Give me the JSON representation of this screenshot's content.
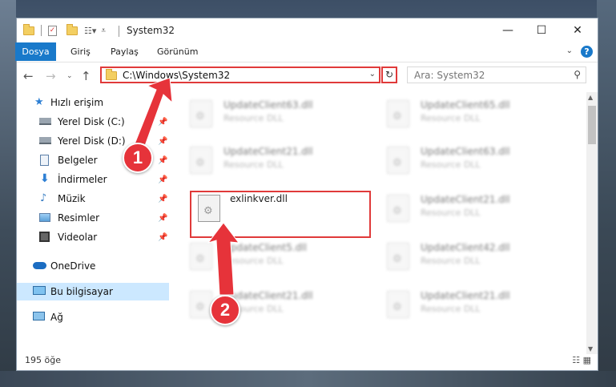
{
  "window": {
    "title": "System32",
    "controls": {
      "minimize": "—",
      "maximize": "☐",
      "close": "✕"
    }
  },
  "ribbon": {
    "tabs": [
      "Dosya",
      "Giriş",
      "Paylaş",
      "Görünüm"
    ],
    "help": "?"
  },
  "address": {
    "path": "C:\\Windows\\System32",
    "search_placeholder": "Ara: System32"
  },
  "sidebar": {
    "items": [
      {
        "label": "Hızlı erişim",
        "icon": "star-icon",
        "pinned": false
      },
      {
        "label": "Yerel Disk (C:)",
        "icon": "disk-icon",
        "pinned": true
      },
      {
        "label": "Yerel Disk (D:)",
        "icon": "disk-icon",
        "pinned": true
      },
      {
        "label": "Belgeler",
        "icon": "documents-icon",
        "pinned": true
      },
      {
        "label": "İndirmeler",
        "icon": "download-icon",
        "pinned": true
      },
      {
        "label": "Müzik",
        "icon": "music-icon",
        "pinned": true
      },
      {
        "label": "Resimler",
        "icon": "pictures-icon",
        "pinned": true
      },
      {
        "label": "Videolar",
        "icon": "videos-icon",
        "pinned": true
      },
      {
        "label": "OneDrive",
        "icon": "onedrive-icon",
        "pinned": false
      },
      {
        "label": "Bu bilgisayar",
        "icon": "computer-icon",
        "pinned": false
      },
      {
        "label": "Ağ",
        "icon": "network-icon",
        "pinned": false
      }
    ]
  },
  "files": [
    {
      "name": "UpdateClient63.dll",
      "type": "Resource DLL"
    },
    {
      "name": "UpdateClient65.dll",
      "type": "Resource DLL"
    },
    {
      "name": "UpdateClient21.dll",
      "type": "Resource DLL"
    },
    {
      "name": "UpdateClient63.dll",
      "type": "Resource DLL"
    },
    {
      "name": "exlinkver.dll",
      "type": ""
    },
    {
      "name": "UpdateClient21.dll",
      "type": "Resource DLL"
    },
    {
      "name": "UpdateClient5.dll",
      "type": "Resource DLL"
    },
    {
      "name": "UpdateClient42.dll",
      "type": "Resource DLL"
    },
    {
      "name": "UpdateClient21.dll",
      "type": "Resource DLL"
    },
    {
      "name": "UpdateClient21.dll",
      "type": "Resource DLL"
    }
  ],
  "status": {
    "count": "195 öğe"
  },
  "annotations": {
    "step1": "1",
    "step2": "2",
    "color": "#e6333a"
  }
}
